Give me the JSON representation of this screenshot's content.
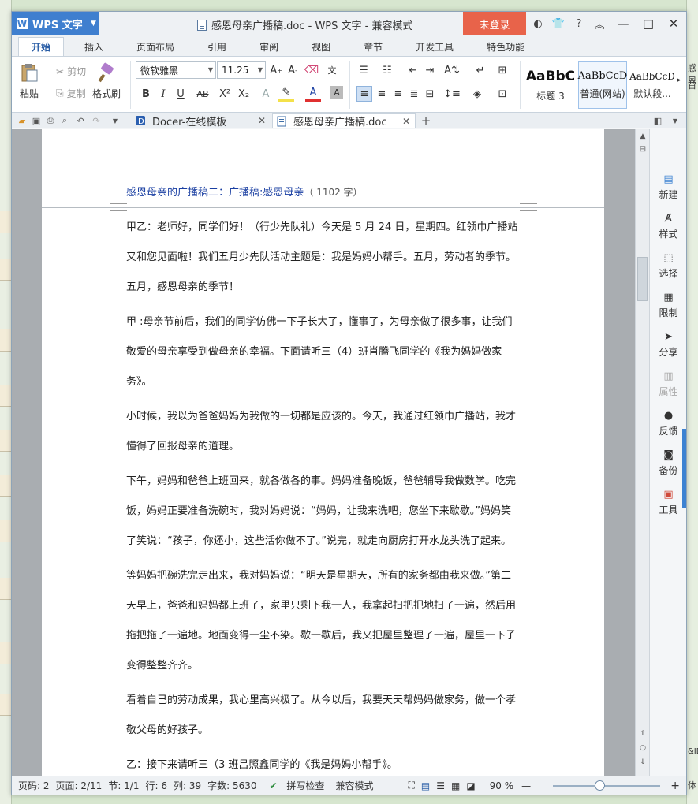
{
  "app": {
    "name": "WPS 文字",
    "doc_title": "感恩母亲广播稿.doc - WPS 文字 - 兼容模式",
    "login": "未登录"
  },
  "ribbon_tabs": [
    "开始",
    "插入",
    "页面布局",
    "引用",
    "审阅",
    "视图",
    "章节",
    "开发工具",
    "特色功能"
  ],
  "clipboard": {
    "paste": "粘贴",
    "cut": "剪切",
    "copy": "复制",
    "format_painter": "格式刷"
  },
  "font": {
    "name": "微软雅黑",
    "size": "11.25"
  },
  "styles": [
    {
      "preview": "AaBbC",
      "label": "标题 3"
    },
    {
      "preview": "AaBbCcD",
      "label": "普通(网站)"
    },
    {
      "preview": "AaBbCcD",
      "label": "默认段..."
    }
  ],
  "doc_tabs": [
    {
      "label": "Docer-在线模板"
    },
    {
      "label": "感恩母亲广播稿.doc"
    }
  ],
  "document": {
    "prev_header": "感恩母亲的广播稿二：广播稿:感恩母亲",
    "prev_count": "（ 1102 字）",
    "paragraphs": [
      "甲乙：老师好，同学们好！（行少先队礼）今天是 5 月 24 日，星期四。红领巾广播站又和您见面啦！我们五月少先队活动主题是：我是妈妈小帮手。五月，劳动者的季节。五月，感恩母亲的季节！",
      "甲 :母亲节前后，我们的同学仿佛一下子长大了，懂事了，为母亲做了很多事，让我们敬爱的母亲享受到做母亲的幸福。下面请听三（4）班肖腾飞同学的《我为妈妈做家务》。",
      "小时候，我以为爸爸妈妈为我做的一切都是应该的。今天，我通过红领巾广播站，我才懂得了回报母亲的道理。",
      "下午，妈妈和爸爸上班回来，就各做各的事。妈妈准备晚饭，爸爸辅导我做数学。吃完饭，妈妈正要准备洗碗时，我对妈妈说：“妈妈，让我来洗吧，您坐下来歇歇。”妈妈笑了笑说：“孩子，你还小，这些活你做不了。”说完，就走向厨房打开水龙头洗了起来。",
      "等妈妈把碗洗完走出来，我对妈妈说：“明天是星期天，所有的家务都由我来做。”第二天早上，爸爸和妈妈都上班了，家里只剩下我一人，我拿起扫把把地扫了一遍，然后用拖把拖了一遍地。地面变得一尘不染。歇一歇后，我又把屋里整理了一遍，屋里一下子变得整整齐齐。",
      "看着自己的劳动成果，我心里高兴极了。从今以后，我要天天帮妈妈做家务，做一个孝敬父母的好孩子。",
      "乙：接下来请听三（3 班吕照鑫同学的《我是妈妈小帮手》。"
    ]
  },
  "task_panel": [
    "新建",
    "样式",
    "选择",
    "限制",
    "分享",
    "属性",
    "反馈",
    "备份",
    "工具"
  ],
  "status": {
    "page": "页码: 2",
    "pages": "页面: 2/11",
    "section": "节: 1/1",
    "row": "行: 6",
    "col": "列: 39",
    "words": "字数: 5630",
    "spell": "拼写检查",
    "compat": "兼容模式",
    "zoom": "90 %"
  },
  "right_strip": [
    "感恩",
    "首",
    "&ID",
    "体"
  ]
}
